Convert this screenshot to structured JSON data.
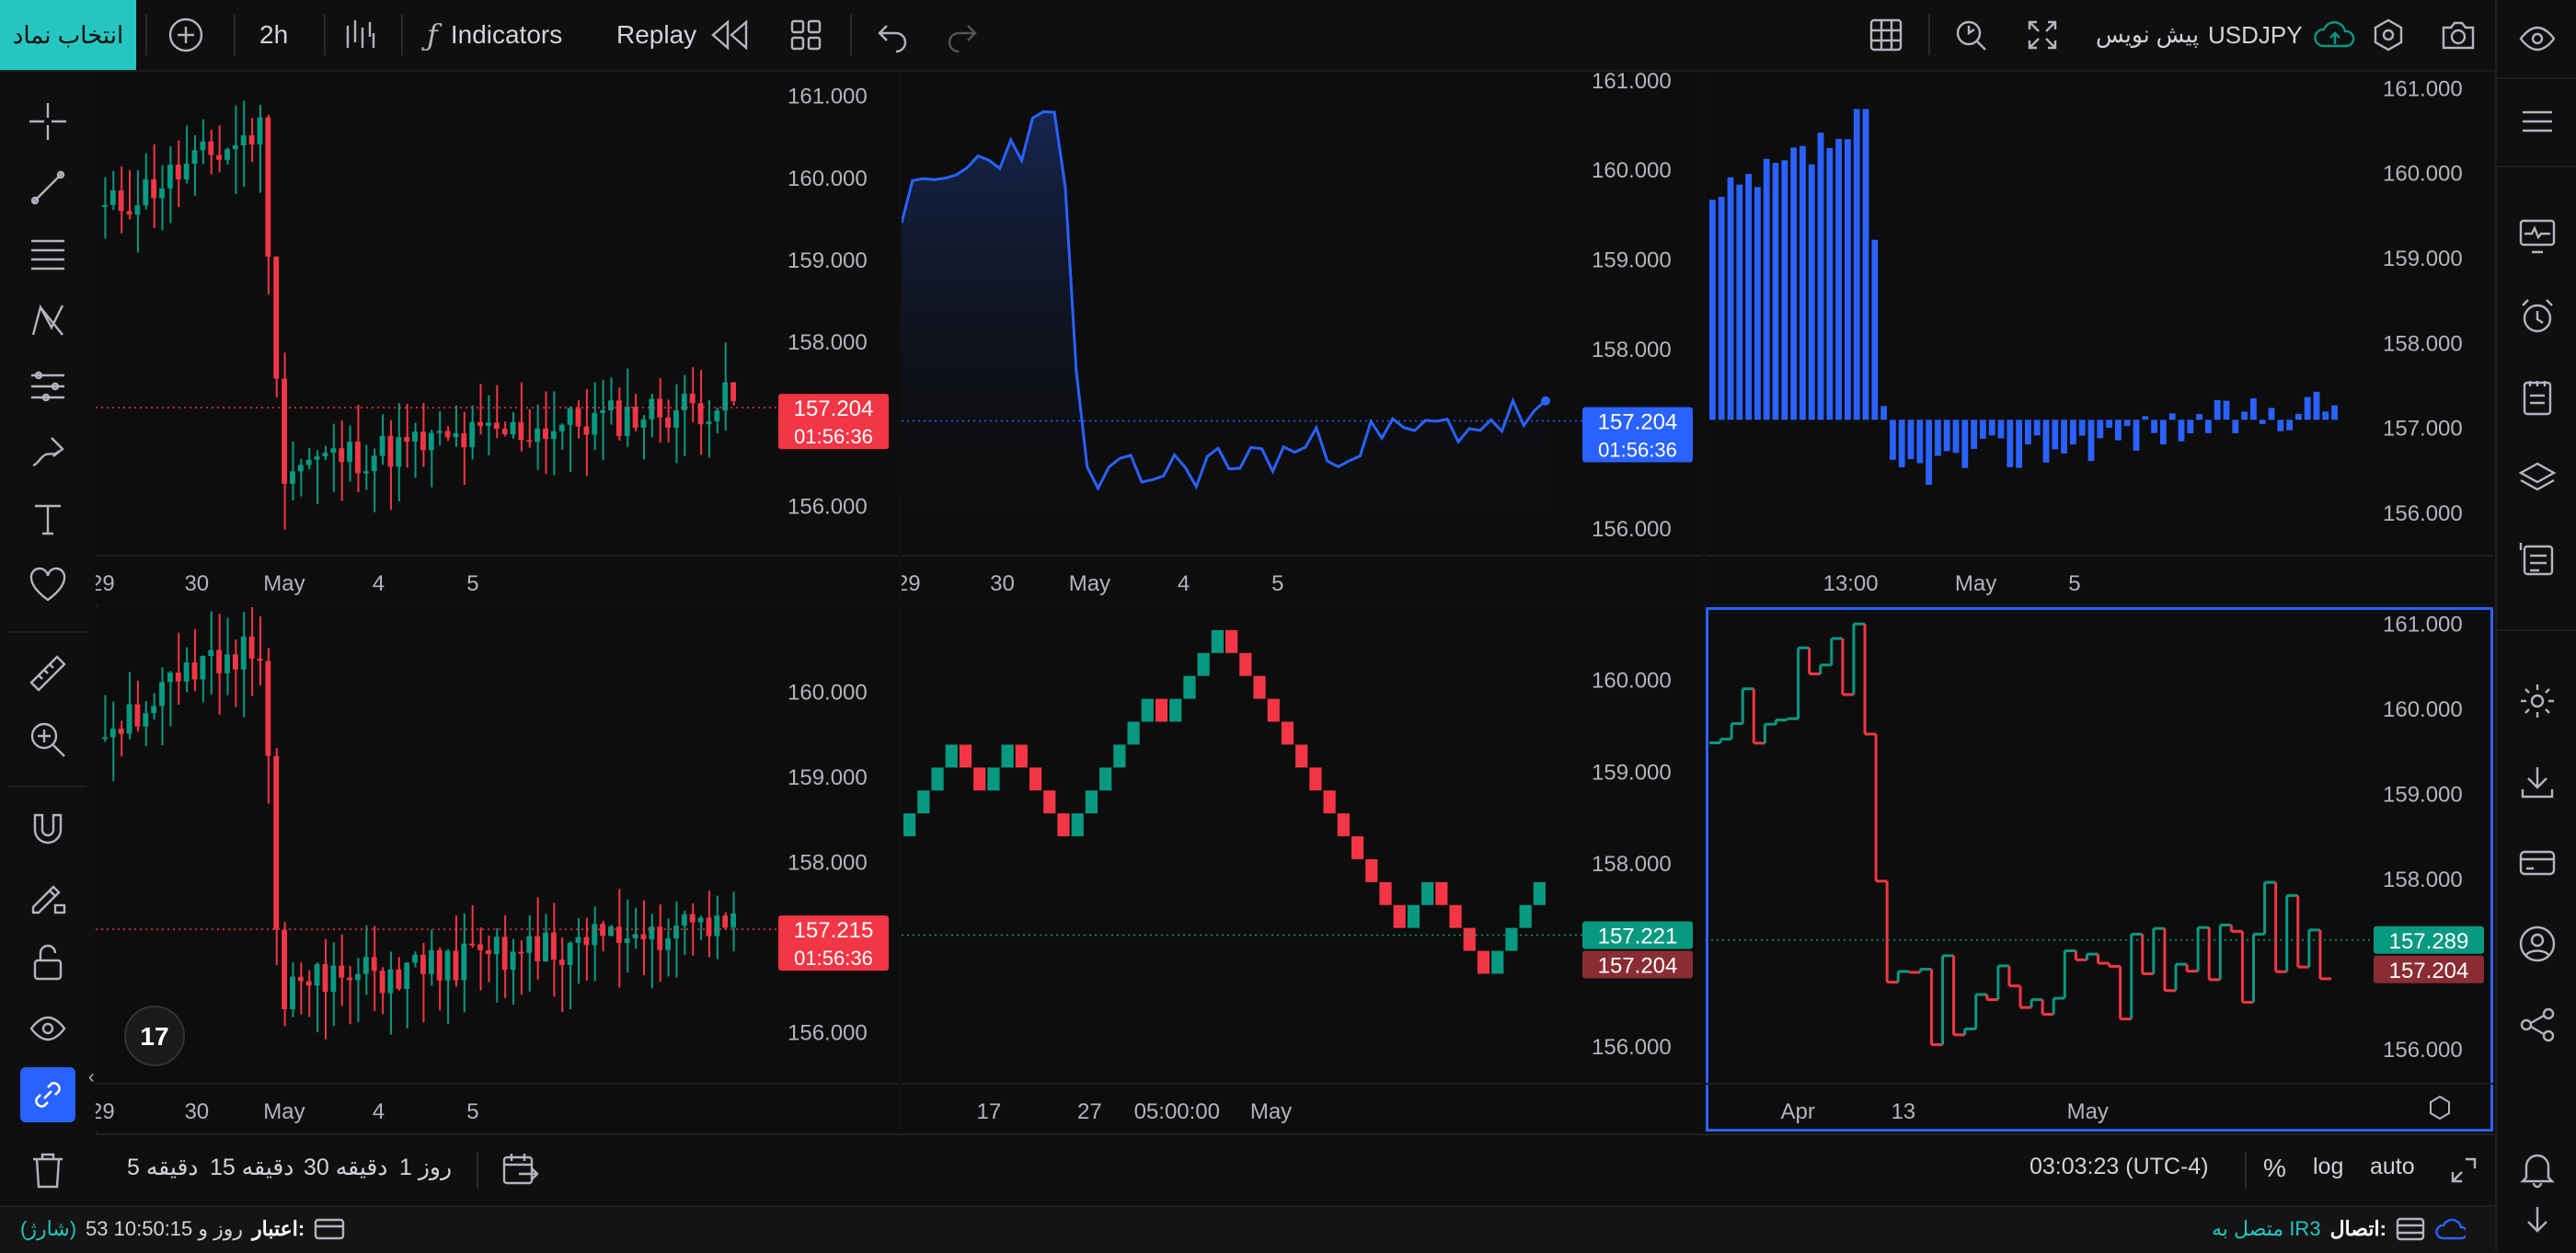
{
  "toolbar": {
    "symbol_search": "انتخاب نماد",
    "interval": "2h",
    "indicators": "Indicators",
    "replay": "Replay",
    "symbol": "USDJPY",
    "draft": "پیش نویس"
  },
  "charts": [
    {
      "id": "top-left-candles",
      "y_ticks": [
        "161.000",
        "160.000",
        "159.000",
        "158.000",
        "157.000",
        "156.000"
      ],
      "x_ticks": [
        "29",
        "30",
        "May",
        "4",
        "5"
      ],
      "last_price": "157.204",
      "countdown": "01:56:36",
      "tag_color": "#f23645"
    },
    {
      "id": "top-middle-area",
      "y_ticks": [
        "161.000",
        "160.000",
        "159.000",
        "158.000",
        "157.000",
        "156.000"
      ],
      "x_ticks": [
        "29",
        "30",
        "May",
        "4",
        "5"
      ],
      "last_price": "157.204",
      "countdown": "01:56:36",
      "tag_color": "#2962ff"
    },
    {
      "id": "top-right-columns",
      "y_ticks": [
        "161.000",
        "160.000",
        "159.000",
        "158.000",
        "157.000",
        "156.000"
      ],
      "x_ticks": [
        "13:00",
        "May",
        "5"
      ]
    },
    {
      "id": "bottom-left-candles",
      "y_ticks": [
        "160.000",
        "159.000",
        "158.000",
        "156.000"
      ],
      "x_ticks": [
        "29",
        "30",
        "May",
        "4",
        "5"
      ],
      "last_price": "157.215",
      "countdown": "01:56:36",
      "tag_color": "#f23645"
    },
    {
      "id": "bottom-middle-renko",
      "y_ticks": [
        "160.000",
        "159.000",
        "158.000",
        "156.000"
      ],
      "x_ticks": [
        "17",
        "27",
        "05:00:00",
        "May"
      ],
      "last_price": "157.221",
      "last_price_2": "157.204",
      "tag_color": "#089981",
      "tag_color_2": "#8a2c33"
    },
    {
      "id": "bottom-right-kagi",
      "y_ticks": [
        "161.000",
        "160.000",
        "159.000",
        "158.000",
        "156.000"
      ],
      "x_ticks": [
        "Apr",
        "13",
        "May"
      ],
      "last_price": "157.289",
      "last_price_2": "157.204",
      "tag_color": "#089981",
      "tag_color_2": "#8a2c33"
    }
  ],
  "bottom": {
    "timeframes": [
      "5 دقیقه",
      "15 دقیقه",
      "30 دقیقه",
      "1 روز"
    ],
    "clock": "03:03:23 (UTC-4)",
    "percent": "%",
    "log": "log",
    "auto": "auto"
  },
  "status": {
    "credit_label": "اعتبار:",
    "credit_value": "53 روز و 10:50:15",
    "charge": "(شارژ)",
    "connection_label": "اتصال:",
    "connection_value": "متصل به IR3"
  },
  "colors": {
    "up": "#089981",
    "down": "#f23645",
    "line": "#2962ff",
    "accent": "#26c6c0"
  }
}
